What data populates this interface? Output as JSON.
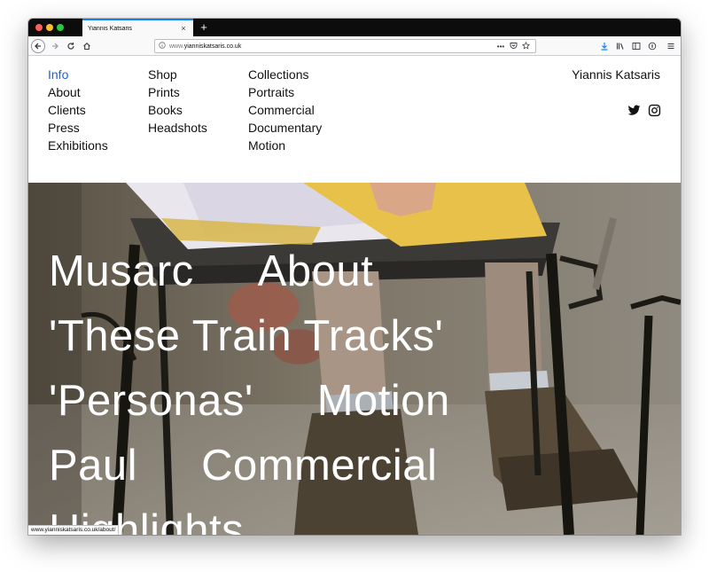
{
  "browser": {
    "tab_title": "Yiannis Katsaris",
    "tab_close": "×",
    "new_tab": "+",
    "url_prefix": "www.",
    "url_host": "yianniskatsaris.co.uk",
    "url_more": "•••",
    "status_url": "www.yianniskatsaris.co.uk/about/"
  },
  "site": {
    "title": "Yiannis Katsaris",
    "nav": {
      "col1": [
        "Info",
        "About",
        "Clients",
        "Press",
        "Exhibitions"
      ],
      "col2": [
        "Shop",
        "Prints",
        "Books",
        "Headshots"
      ],
      "col3": [
        "Collections",
        "Portraits",
        "Commercial",
        "Documentary",
        "Motion"
      ],
      "active": "Info"
    },
    "social": [
      "twitter-icon",
      "instagram-icon"
    ],
    "hero_links": [
      [
        "Musarc",
        "About"
      ],
      [
        "'These Train Tracks'"
      ],
      [
        "'Personas'",
        "Motion"
      ],
      [
        "Paul",
        "Commercial"
      ],
      [
        "Highlights"
      ]
    ]
  },
  "colors": {
    "active_link": "#1f5fdb",
    "tab_accent": "#0a84ff"
  }
}
